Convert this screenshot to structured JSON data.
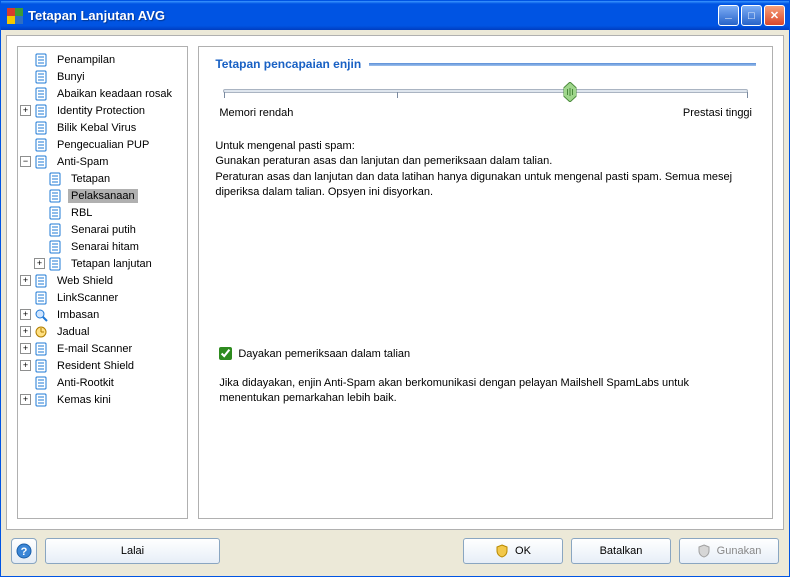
{
  "title": "Tetapan Lanjutan AVG",
  "tree": {
    "penampilan": "Penampilan",
    "bunyi": "Bunyi",
    "abaikan": "Abaikan keadaan rosak",
    "identity": "Identity Protection",
    "bilik": "Bilik Kebal Virus",
    "pengecualian": "Pengecualian PUP",
    "antispam": "Anti-Spam",
    "antispam_children": {
      "tetapan": "Tetapan",
      "pelaksanaan": "Pelaksanaan",
      "rbl": "RBL",
      "senarai_putih": "Senarai putih",
      "senarai_hitam": "Senarai hitam",
      "tetapan_lanjutan": "Tetapan lanjutan"
    },
    "webshield": "Web Shield",
    "linkscanner": "LinkScanner",
    "imbasan": "Imbasan",
    "jadual": "Jadual",
    "email": "E-mail Scanner",
    "resident": "Resident Shield",
    "antirootkit": "Anti-Rootkit",
    "kemas": "Kemas kini"
  },
  "content": {
    "section_title": "Tetapan pencapaian enjin",
    "slider_low": "Memori rendah",
    "slider_high": "Prestasi tinggi",
    "desc_line1": "Untuk mengenal pasti spam:",
    "desc_line2": "Gunakan peraturan asas dan lanjutan dan pemeriksaan dalam talian.",
    "desc_line3": "Peraturan asas dan lanjutan dan data latihan hanya digunakan untuk mengenal pasti spam. Semua mesej diperiksa dalam talian. Opsyen ini disyorkan.",
    "checkbox_label": "Dayakan pemeriksaan dalam talian",
    "online_desc": "Jika didayakan, enjin Anti-Spam akan berkomunikasi dengan pelayan Mailshell SpamLabs untuk menentukan pemarkahan lebih baik."
  },
  "footer": {
    "default": "Lalai",
    "ok": "OK",
    "cancel": "Batalkan",
    "apply": "Gunakan"
  }
}
